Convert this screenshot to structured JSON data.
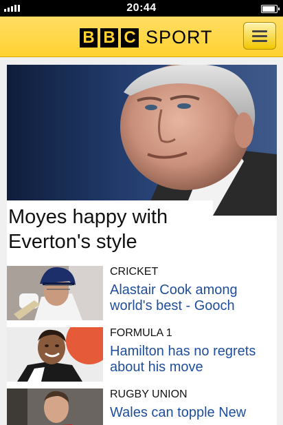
{
  "status_bar": {
    "time": "20:44",
    "signal_icon": "signal-bars-icon",
    "battery_icon": "battery-icon",
    "battery_level": 0.9
  },
  "header": {
    "brand_letters": [
      "B",
      "B",
      "C"
    ],
    "brand_section": "SPORT",
    "menu_icon": "hamburger-menu-icon",
    "background": "#ffd230",
    "logo_block_color": "#000000"
  },
  "hero": {
    "headline": "Moyes happy with Everton's style",
    "image_icon": "photo-david-moyes"
  },
  "stories": [
    {
      "category": "CRICKET",
      "title": "Alastair Cook among world's best - Gooch",
      "image_icon": "photo-cricketer"
    },
    {
      "category": "FORMULA 1",
      "title": "Hamilton has no regrets about his move",
      "image_icon": "photo-lewis-hamilton"
    },
    {
      "category": "RUGBY UNION",
      "title": "Wales can topple New",
      "image_icon": "photo-rugby-player"
    }
  ],
  "colors": {
    "link_blue": "#1f4e9c",
    "page_bg": "#f0f0f0"
  }
}
